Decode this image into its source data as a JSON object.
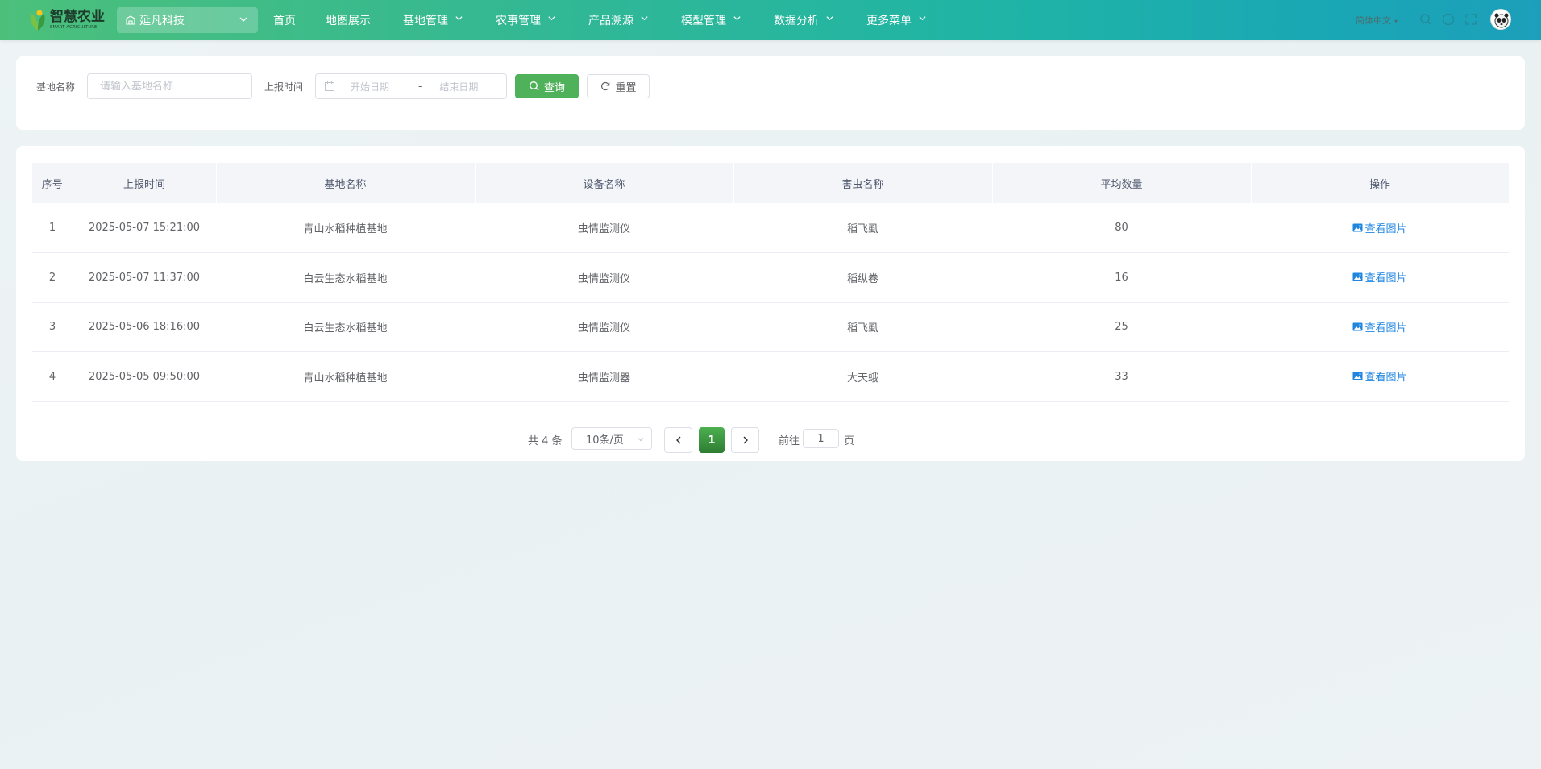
{
  "brand": {
    "title": "智慧农业",
    "subtitle": "SMART AGRICULTURE"
  },
  "tenant": {
    "name": "延凡科技"
  },
  "nav": {
    "items": [
      {
        "label": "首页",
        "has_dropdown": false
      },
      {
        "label": "地图展示",
        "has_dropdown": false
      },
      {
        "label": "基地管理",
        "has_dropdown": true
      },
      {
        "label": "农事管理",
        "has_dropdown": true
      },
      {
        "label": "产品溯源",
        "has_dropdown": true
      },
      {
        "label": "模型管理",
        "has_dropdown": true
      },
      {
        "label": "数据分析",
        "has_dropdown": true
      },
      {
        "label": "更多菜单",
        "has_dropdown": true
      }
    ]
  },
  "header_right": {
    "language": "简体中文",
    "icons": [
      "search-icon",
      "github-icon",
      "fullscreen-icon",
      "font-size-icon"
    ]
  },
  "search": {
    "base_name_label": "基地名称",
    "base_name_placeholder": "请输入基地名称",
    "report_time_label": "上报时间",
    "start_placeholder": "开始日期",
    "range_separator": "-",
    "end_placeholder": "结束日期",
    "query_button": "查询",
    "reset_button": "重置"
  },
  "table": {
    "columns": [
      "序号",
      "上报时间",
      "基地名称",
      "设备名称",
      "害虫名称",
      "平均数量",
      "操作"
    ],
    "rows": [
      {
        "index": "1",
        "time": "2025-05-07 15:21:00",
        "base": "青山水稻种植基地",
        "device": "虫情监测仪",
        "pest": "稻飞虱",
        "avg": "80",
        "action": "查看图片"
      },
      {
        "index": "2",
        "time": "2025-05-07 11:37:00",
        "base": "白云生态水稻基地",
        "device": "虫情监测仪",
        "pest": "稻纵卷",
        "avg": "16",
        "action": "查看图片"
      },
      {
        "index": "3",
        "time": "2025-05-06 18:16:00",
        "base": "白云生态水稻基地",
        "device": "虫情监测仪",
        "pest": "稻飞虱",
        "avg": "25",
        "action": "查看图片"
      },
      {
        "index": "4",
        "time": "2025-05-05 09:50:00",
        "base": "青山水稻种植基地",
        "device": "虫情监测器",
        "pest": "大天蛾",
        "avg": "33",
        "action": "查看图片"
      }
    ]
  },
  "pagination": {
    "total_text": "共 4 条",
    "page_size": "10条/页",
    "current_page": "1",
    "goto_label": "前往",
    "goto_value": "1",
    "goto_suffix": "页"
  },
  "colors": {
    "primary": "#4fb25a",
    "link": "#1f86e0",
    "header_gradient_start": "#4cc07b",
    "header_gradient_end": "#1c9fbb"
  }
}
